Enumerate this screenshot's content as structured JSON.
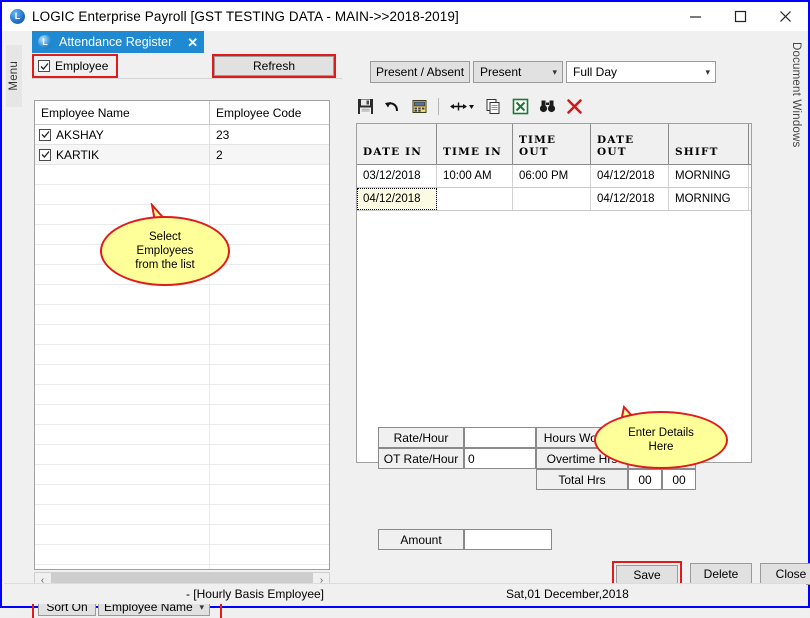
{
  "window": {
    "title": "LOGIC Enterprise Payroll  [GST TESTING DATA - MAIN->>2018-2019]",
    "app_icon": "logic-app-icon",
    "minimize": "minimize-icon",
    "maximize": "maximize-icon",
    "close": "close-icon"
  },
  "side_panels": {
    "menu_label": "Menu",
    "document_windows_label": "Document Windows"
  },
  "tab": {
    "label": "Attendance Register",
    "close": "✕"
  },
  "left_pane": {
    "employee_checkbox_label": "Employee",
    "employee_checked": true,
    "refresh_label": "Refresh",
    "columns": [
      "Employee Name",
      "Employee Code"
    ],
    "rows": [
      {
        "name": "AKSHAY",
        "code": "23",
        "checked": true
      },
      {
        "name": "KARTIK",
        "code": "2",
        "checked": true
      }
    ],
    "sort_on_label": "Sort On",
    "sort_on_value": "Employee Name",
    "scroll_left_icon": "‹",
    "scroll_right_icon": "›"
  },
  "callouts": [
    {
      "text_lines": [
        "Select",
        "Employees",
        "from the list"
      ]
    },
    {
      "text_lines": [
        "Enter Details",
        "Here"
      ]
    }
  ],
  "right_pane": {
    "present_absent_label": "Present / Absent",
    "present_value": "Present",
    "day_value": "Full Day",
    "toolbar": [
      {
        "name": "save-icon",
        "title": "Save"
      },
      {
        "name": "undo-icon",
        "title": "Undo"
      },
      {
        "name": "note-icon",
        "title": "Note"
      },
      {
        "name": "fit-width-icon",
        "title": "Fit Width"
      },
      {
        "name": "copy-icon",
        "title": "Copy"
      },
      {
        "name": "excel-export-icon",
        "title": "Export to Excel"
      },
      {
        "name": "find-icon",
        "title": "Find"
      },
      {
        "name": "delete-icon",
        "title": "Delete"
      }
    ],
    "grid": {
      "columns": [
        "DATE IN",
        "TIME IN",
        "TIME OUT",
        "DATE OUT",
        "SHIFT"
      ],
      "rows": [
        {
          "date_in": "03/12/2018",
          "time_in": "10:00 AM",
          "time_out": "06:00 PM",
          "date_out": "04/12/2018",
          "shift": "MORNING",
          "selected": false
        },
        {
          "date_in": "04/12/2018",
          "time_in": "",
          "time_out": "",
          "date_out": "04/12/2018",
          "shift": "MORNING",
          "selected": true
        }
      ]
    },
    "fields": {
      "rate_hour_label": "Rate/Hour",
      "rate_hour_value": "",
      "ot_rate_hour_label": "OT Rate/Hour",
      "ot_rate_hour_value": "0",
      "hours_worked_label": "Hours Worked",
      "hours_worked_h": "",
      "hours_worked_m": "",
      "overtime_label": "Overtime Hrs",
      "overtime_h": "",
      "overtime_m": "",
      "total_label": "Total Hrs",
      "total_h": "00",
      "total_m": "00",
      "amount_label": "Amount",
      "amount_value": ""
    },
    "buttons": {
      "save": "Save",
      "delete": "Delete",
      "close": "Close"
    }
  },
  "statusbar": {
    "left_text": "- [Hourly Basis Employee]",
    "right_text": "Sat,01 December,2018"
  },
  "colors": {
    "accent": "#1f8ad2",
    "highlight": "#e01b1b",
    "callout_fill": "#ffff99",
    "window_border": "#0000ff"
  }
}
